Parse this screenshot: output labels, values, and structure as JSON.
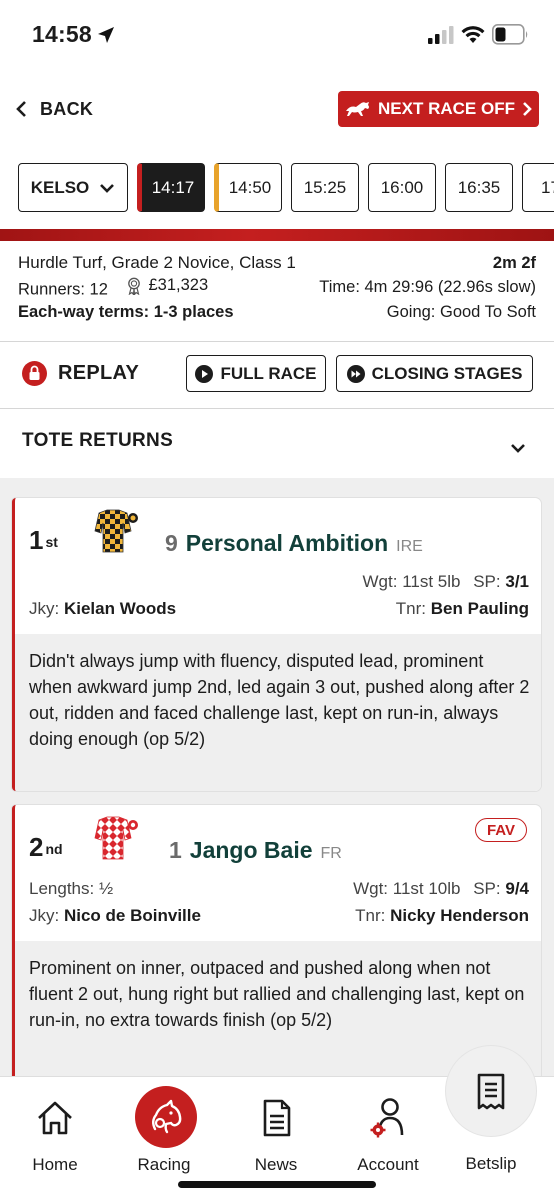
{
  "status": {
    "time": "14:58"
  },
  "nav": {
    "back_label": "BACK",
    "next_race_label": "NEXT RACE OFF"
  },
  "course": {
    "name": "KELSO",
    "times": [
      "14:17",
      "14:50",
      "15:25",
      "16:00",
      "16:35",
      "17:"
    ],
    "active_time": "14:17"
  },
  "race": {
    "title": "Hurdle Turf, Grade 2 Novice, Class 1",
    "distance": "2m 2f",
    "runners": "Runners: 12",
    "prize": "£31,323",
    "time": "Time: 4m 29:96 (22.96s slow)",
    "each_way": "Each-way terms: 1-3 places",
    "going": "Going: Good To Soft"
  },
  "replay": {
    "label": "REPLAY",
    "full_race": "FULL RACE",
    "closing_stages": "CLOSING STAGES"
  },
  "tote": {
    "label": "TOTE RETURNS"
  },
  "results": [
    {
      "position": "1",
      "suffix": "st",
      "number": "9",
      "name": "Personal Ambition",
      "country": "IRE",
      "weight_label": "Wgt:",
      "weight": "11st 5lb",
      "sp_label": "SP:",
      "sp": "3/1",
      "jockey_label": "Jky:",
      "jockey": "Kielan Woods",
      "trainer_label": "Tnr:",
      "trainer": "Ben Pauling",
      "comment": "Didn't always jump with fluency, disputed lead, prominent when awkward jump 2nd, led again 3 out, pushed along after 2 out, ridden and faced challenge last, kept on run-in, always doing enough (op 5/2)"
    },
    {
      "position": "2",
      "suffix": "nd",
      "number": "1",
      "name": "Jango Baie",
      "country": "FR",
      "badge": "FAV",
      "lengths_label": "Lengths:",
      "lengths": "½",
      "weight_label": "Wgt:",
      "weight": "11st 10lb",
      "sp_label": "SP:",
      "sp": "9/4",
      "jockey_label": "Jky:",
      "jockey": "Nico de Boinville",
      "trainer_label": "Tnr:",
      "trainer": "Nicky Henderson",
      "comment": "Prominent on inner, outpaced and pushed along when not fluent 2 out, hung right but rallied and challenging last, kept on run-in, no extra towards finish (op 5/2)"
    }
  ],
  "bottom_nav": {
    "home": "Home",
    "racing": "Racing",
    "news": "News",
    "account": "Account",
    "betslip": "Betslip"
  },
  "colors": {
    "brand_red": "#c41f1f",
    "amber": "#e8a32b",
    "dark_green": "#12403a"
  }
}
